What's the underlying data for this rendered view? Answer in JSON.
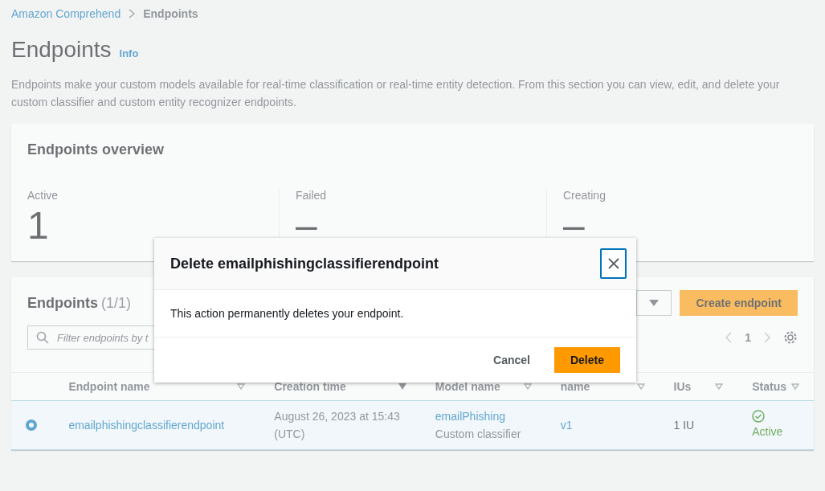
{
  "breadcrumb": [
    {
      "label": "Amazon Comprehend",
      "kind": "link"
    },
    {
      "label": "Endpoints",
      "kind": "current"
    }
  ],
  "page": {
    "title": "Endpoints",
    "info": "Info",
    "description": "Endpoints make your custom models available for real-time classification or real-time entity detection. From this section you can view, edit, and delete your custom classifier and custom entity recognizer endpoints."
  },
  "overview": {
    "title": "Endpoints overview",
    "stats": [
      {
        "label": "Active",
        "value": "1"
      },
      {
        "label": "Failed",
        "value": "–"
      },
      {
        "label": "Creating",
        "value": "–"
      }
    ]
  },
  "endpoints": {
    "title": "Endpoints",
    "count": "(1/1)",
    "create_button": "Create endpoint",
    "filter": {
      "placeholder": "Filter endpoints by t"
    },
    "page": "1",
    "columns": [
      {
        "label": "Endpoint name",
        "sorted": false
      },
      {
        "label": "Creation time",
        "sorted": true
      },
      {
        "label": "Model name",
        "sorted": false
      },
      {
        "label": "name",
        "sorted": false
      },
      {
        "label": "IUs",
        "sorted": false
      },
      {
        "label": "Status",
        "sorted": false
      }
    ],
    "rows": [
      {
        "selected": true,
        "name": "emailphishingclassifierendpoint",
        "creation_time": "August 26, 2023 at 15:43 (UTC)",
        "model_name": "emailPhishing",
        "model_type": "Custom classifier",
        "version": "v1",
        "ius": "1 IU",
        "status": "Active"
      }
    ]
  },
  "dialog": {
    "title": "Delete emailphishingclassifierendpoint",
    "message": "This action permanently deletes your endpoint.",
    "buttons": [
      {
        "label": "Cancel",
        "kind": "link"
      },
      {
        "label": "Delete",
        "kind": "primary"
      }
    ]
  }
}
